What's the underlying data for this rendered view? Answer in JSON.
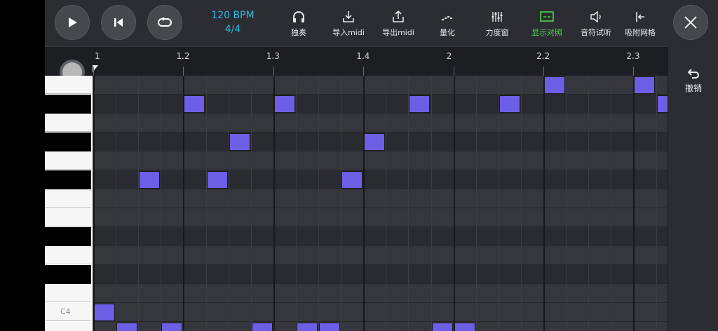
{
  "transport": {
    "play_icon": "play-icon",
    "prev_icon": "skip-back-icon",
    "loop_icon": "loop-icon"
  },
  "tempo": {
    "bpm": "120 BPM",
    "time_signature": "4/4"
  },
  "tools": [
    {
      "label": "独奏",
      "icon": "headphones-icon"
    },
    {
      "label": "导入midi",
      "icon": "import-icon"
    },
    {
      "label": "导出midi",
      "icon": "export-icon"
    },
    {
      "label": "量化",
      "icon": "quantize-icon"
    },
    {
      "label": "力度窗",
      "icon": "velocity-icon"
    },
    {
      "label": "显示对照",
      "icon": "compare-icon",
      "active": true
    },
    {
      "label": "音符试听",
      "icon": "speaker-icon"
    },
    {
      "label": "吸附网格",
      "icon": "snap-icon"
    }
  ],
  "close_icon": "close-icon",
  "ruler": {
    "marks": [
      "1",
      "1.2",
      "1.3",
      "1.4",
      "2",
      "2.2",
      "2.3"
    ]
  },
  "keys": {
    "label_c4": "C4"
  },
  "notes": [
    {
      "bar": 1,
      "sixteenth": 0,
      "row": 12
    },
    {
      "bar": 1,
      "sixteenth": 1,
      "row": 13
    },
    {
      "bar": 1,
      "sixteenth": 2,
      "row": 5
    },
    {
      "bar": 1,
      "sixteenth": 3,
      "row": 13
    },
    {
      "bar": 1,
      "sixteenth": 4,
      "row": 1
    },
    {
      "bar": 1,
      "sixteenth": 5,
      "row": 5
    },
    {
      "bar": 1,
      "sixteenth": 6,
      "row": 3
    },
    {
      "bar": 1,
      "sixteenth": 7,
      "row": 13
    },
    {
      "bar": 1,
      "sixteenth": 8,
      "row": 1
    },
    {
      "bar": 1,
      "sixteenth": 9,
      "row": 13
    },
    {
      "bar": 1,
      "sixteenth": 10,
      "row": 13
    },
    {
      "bar": 1,
      "sixteenth": 11,
      "row": 5
    },
    {
      "bar": 1,
      "sixteenth": 12,
      "row": 3
    },
    {
      "bar": 1,
      "sixteenth": 14,
      "row": 1
    },
    {
      "bar": 1,
      "sixteenth": 15,
      "row": 13
    },
    {
      "bar": 2,
      "sixteenth": 0,
      "row": 13
    },
    {
      "bar": 2,
      "sixteenth": 2,
      "row": 1
    },
    {
      "bar": 2,
      "sixteenth": 4,
      "row": 0
    },
    {
      "bar": 2,
      "sixteenth": 8,
      "row": 0
    },
    {
      "bar": 2,
      "sixteenth": 9,
      "row": 1
    }
  ],
  "undo": {
    "label": "撤销",
    "icon": "undo-icon"
  },
  "colors": {
    "note": "#6c5fe6",
    "bpm": "#2bb9e6",
    "active_tool": "#4ad84a"
  }
}
